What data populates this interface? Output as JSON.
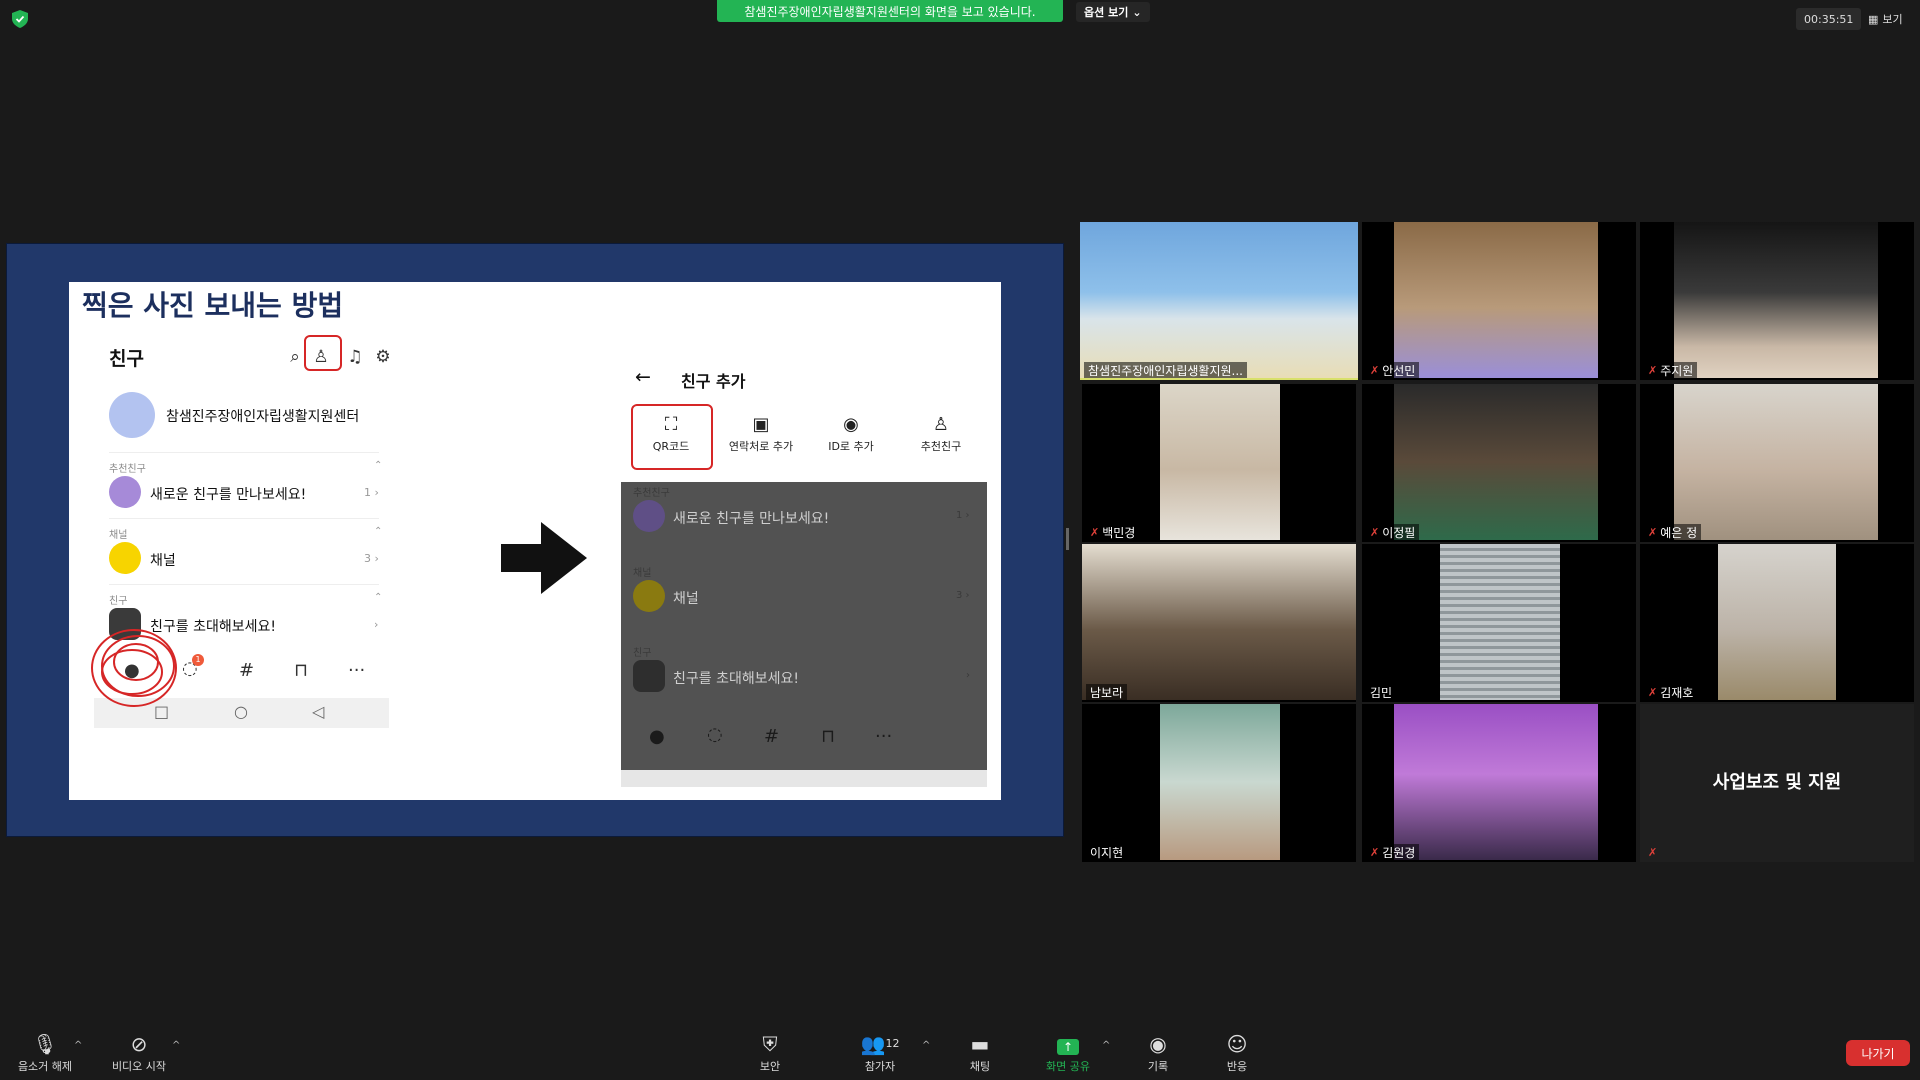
{
  "top_bar": {
    "share_notice": "참샘진주장애인자립생활지원센터의 화면을 보고 있습니다.",
    "view_options_label": "옵션 보기",
    "timer": "00:35:51",
    "view_label": "보기"
  },
  "slide": {
    "title": "찍은 사진 보내는 방법",
    "left_phone": {
      "header": "친구",
      "profile_name": "참샘진주장애인자립생활지원센터",
      "sections": [
        {
          "label": "추천친구",
          "row_text": "새로운 친구를 만나보세요!",
          "count": "1 ›"
        },
        {
          "label": "채널",
          "row_text": "채널",
          "count": "3 ›"
        },
        {
          "label": "친구",
          "row_text": "친구를 초대해보세요!",
          "count": "›"
        }
      ],
      "badge_count": "1"
    },
    "right_phone": {
      "header": "친구 추가",
      "options": [
        {
          "label": "QR코드",
          "icon": "qr-scan-icon"
        },
        {
          "label": "연락처로 추가",
          "icon": "contact-card-icon"
        },
        {
          "label": "ID로 추가",
          "icon": "id-icon"
        },
        {
          "label": "추천친구",
          "icon": "add-friend-icon"
        }
      ],
      "sections": [
        {
          "label": "추천친구",
          "row_text": "새로운 친구를 만나보세요!",
          "count": "1 ›"
        },
        {
          "label": "채널",
          "row_text": "채널",
          "count": "3 ›"
        },
        {
          "label": "친구",
          "row_text": "친구를 초대해보세요!",
          "count": "›"
        }
      ]
    }
  },
  "participants": [
    {
      "name": "참샘진주장애인자립생활지원...",
      "muted": false,
      "active": true
    },
    {
      "name": "안선민",
      "muted": true
    },
    {
      "name": "주지원",
      "muted": true
    },
    {
      "name": "백민경",
      "muted": true
    },
    {
      "name": "이정필",
      "muted": true
    },
    {
      "name": "예은 정",
      "muted": true
    },
    {
      "name": "남보라",
      "muted": false
    },
    {
      "name": "김민",
      "muted": false
    },
    {
      "name": "김재호",
      "muted": true
    },
    {
      "name": "이지현",
      "muted": false
    },
    {
      "name": "김원경",
      "muted": true
    },
    {
      "name": "",
      "muted": true,
      "center_name": "사업보조 및 지원"
    }
  ],
  "toolbar": {
    "unmute": "음소거 해제",
    "start_video": "비디오 시작",
    "security": "보안",
    "participants": "참가자",
    "participant_count": "12",
    "chat": "채팅",
    "share_screen": "화면 공유",
    "record": "기록",
    "reactions": "반응",
    "leave": "나가기"
  },
  "colors": {
    "share_green": "#23b454",
    "leave_red": "#d8302f",
    "slide_bg": "#21386a",
    "active_speaker": "#d8e06b",
    "annotation_red": "#d62626"
  }
}
